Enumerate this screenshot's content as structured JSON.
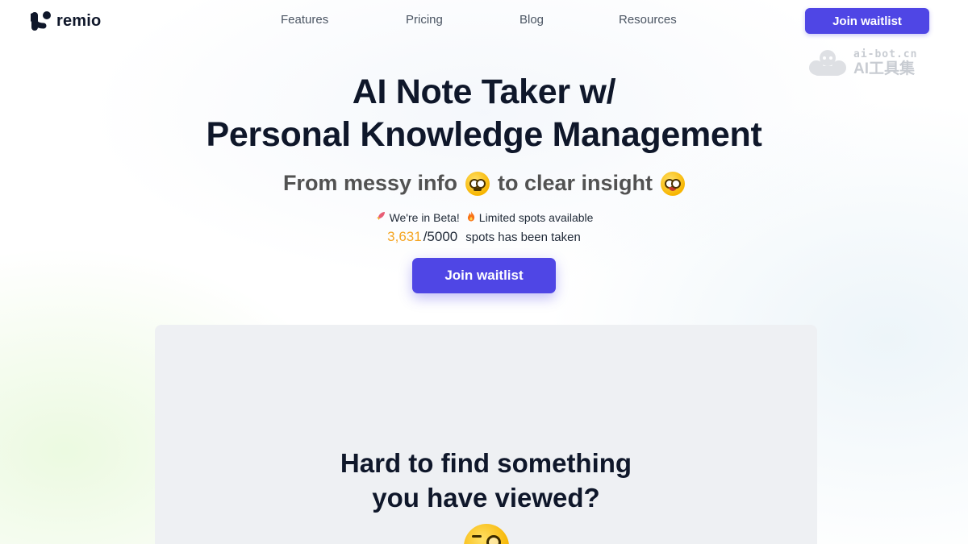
{
  "nav": {
    "brand": "remio",
    "links": [
      "Features",
      "Pricing",
      "Blog",
      "Resources"
    ],
    "cta_label": "Join waitlist"
  },
  "watermark": {
    "line1": "ai-bot.cn",
    "line2": "AI工具集"
  },
  "hero": {
    "title_line1": "AI Note Taker w/",
    "title_line2": "Personal Knowledge Management",
    "subtitle_part1": "From messy info",
    "subtitle_part2": "to clear insight",
    "beta_text": "We're in Beta!",
    "limited_text": "Limited spots available",
    "spots_taken": "3,631",
    "spots_total": "/5000",
    "spots_text": "spots has been taken",
    "cta_label": "Join waitlist"
  },
  "demo": {
    "title_line1": "Hard to find something",
    "title_line2": "you have viewed?"
  },
  "colors": {
    "accent": "#4f46e5",
    "highlight": "#f5a623",
    "card_bg": "#eef0f3"
  },
  "icons": [
    "remio-logo-icon",
    "rocket-icon",
    "fire-icon",
    "confused-face-icon",
    "nerd-face-icon",
    "monocle-face-icon"
  ]
}
